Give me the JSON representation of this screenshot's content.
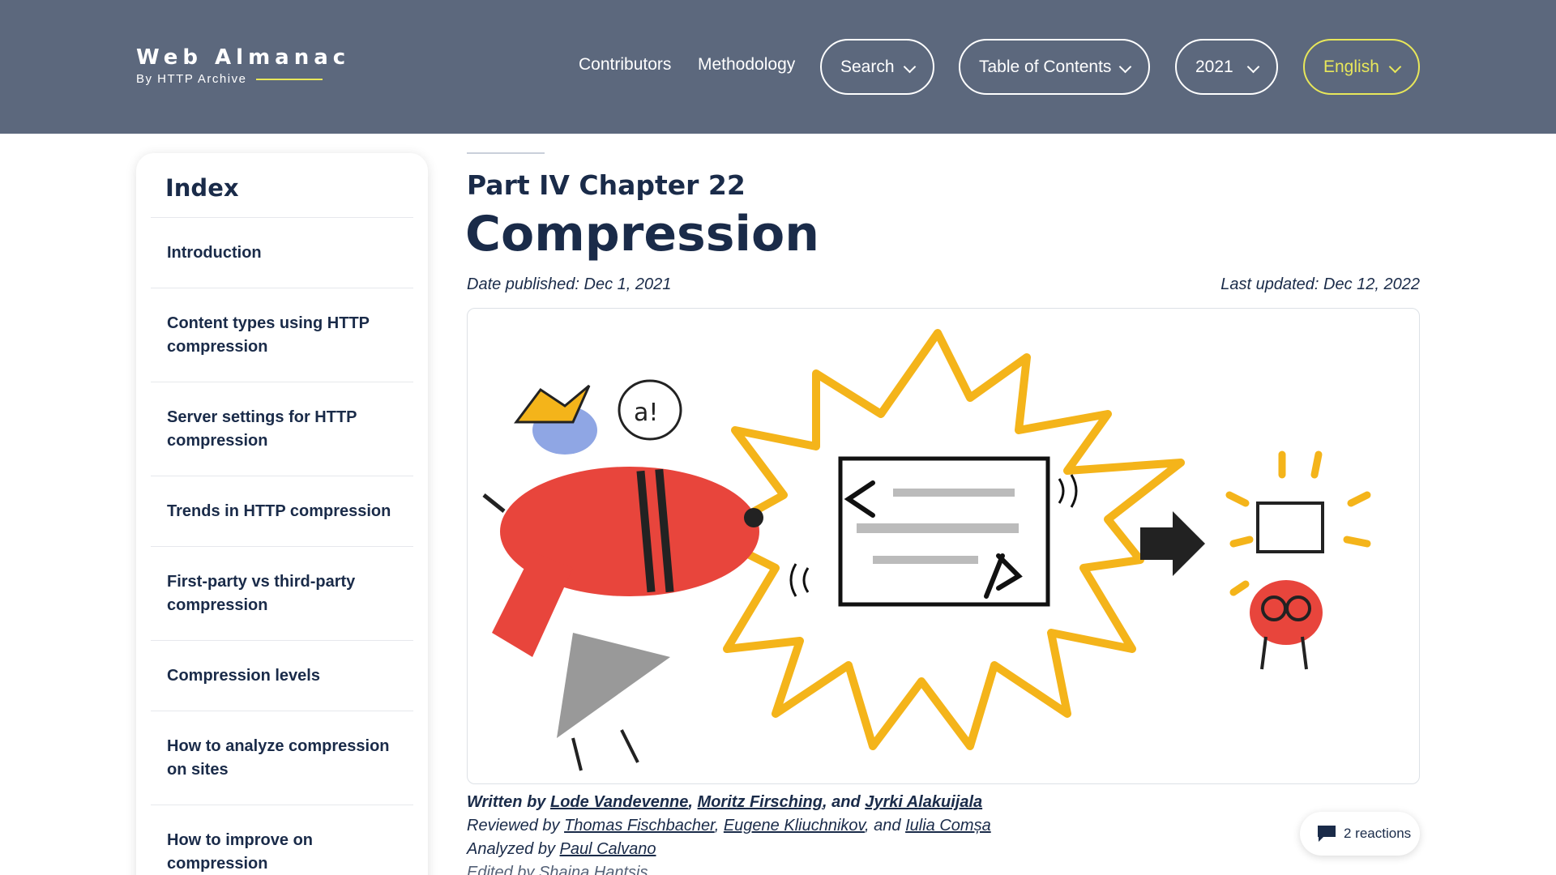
{
  "header": {
    "logo_title": "Web Almanac",
    "logo_subtitle": "By HTTP Archive",
    "nav": {
      "contributors": "Contributors",
      "methodology": "Methodology",
      "search": "Search",
      "toc": "Table of Contents",
      "year": "2021",
      "language": "English"
    },
    "colors": {
      "background": "#5c687d",
      "accent": "#e8e75a"
    }
  },
  "sidebar": {
    "title": "Index",
    "items": [
      {
        "label": "Introduction"
      },
      {
        "label": "Content types using HTTP compression"
      },
      {
        "label": "Server settings for HTTP compression"
      },
      {
        "label": "Trends in HTTP compression"
      },
      {
        "label": "First-party vs third-party compression"
      },
      {
        "label": "Compression levels"
      },
      {
        "label": "How to analyze compression on sites"
      },
      {
        "label": "How to improve on compression"
      }
    ]
  },
  "main": {
    "part": "Part IV Chapter 22",
    "title": "Compression",
    "date_published": "Date published: Dec 1, 2021",
    "last_updated": "Last updated: Dec 12, 2022",
    "hero_image": "compression-illustration",
    "credits": {
      "written_prefix": "Written by",
      "authors": [
        "Lode Vandevenne",
        "Moritz Firsching",
        "Jyrki Alakuijala"
      ],
      "reviewed_prefix": "Reviewed by",
      "reviewers": [
        "Thomas Fischbacher",
        "Eugene Kliuchnikov",
        "Iulia Comșa"
      ],
      "analyzed_prefix": "Analyzed by",
      "analysts": [
        "Paul Calvano"
      ],
      "edited_prefix": "Edited by",
      "editors": [
        "Shaina Hantsis"
      ],
      "sep_comma": ",",
      "sep_and": ", and"
    },
    "reactions": {
      "label": "2 reactions",
      "icon": "comment-icon"
    }
  }
}
